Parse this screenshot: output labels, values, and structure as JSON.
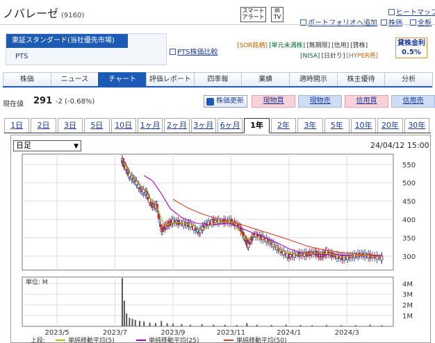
{
  "header": {
    "title": "ノバレーゼ",
    "code": "(9160)",
    "smart_alert": "スマート\nアラート",
    "ir_tv": "IR\nTV",
    "heatmap": "ヒートマップ",
    "portfolio_add": "ポートフォリオへ追加",
    "stock_price": "株価",
    "all_board": "全板"
  },
  "market": {
    "selected": "東証スタンダード(当社優先市場)",
    "pts": "PTS",
    "pts_compare": "PTS株価比較"
  },
  "tags": {
    "row1": [
      "[SOR銘柄]",
      "[単元未満株]",
      "[無期限]",
      "[信用]",
      "[貸株]"
    ],
    "row2": [
      "[NISA]",
      "[日計り]",
      "[HYPER売]"
    ]
  },
  "fee": {
    "label": "貸株金利",
    "value": "0.5%"
  },
  "tabs": [
    "株価",
    "ニュース",
    "チャート",
    "評価レポート",
    "四季報",
    "業績",
    "適時開示",
    "株主優待",
    "分析"
  ],
  "active_tab": "チャート",
  "price": {
    "label": "現在値",
    "value": "291",
    "change": "-2 (-0.68%)"
  },
  "actions": {
    "update": "株価更新",
    "genbutsu_buy": "現物買",
    "genbutsu_sell": "現物売",
    "shinyo_buy": "信用買",
    "shinyo_sell": "信用売"
  },
  "periods": [
    "1日",
    "2日",
    "3日",
    "5日",
    "10日",
    "1ヶ月",
    "2ヶ月",
    "3ヶ月",
    "6ヶ月",
    "1年",
    "2年",
    "3年",
    "5年",
    "10年",
    "20年",
    "30年"
  ],
  "active_period": "1年",
  "chart": {
    "select_value": "日足",
    "date": "24/04/12 15:00",
    "volume_unit": "単位: M",
    "legend_prefix": "上段:",
    "legend": [
      "単純移動平均(5)",
      "単純移動平均(25)",
      "単純移動平均(50)"
    ]
  },
  "chart_data": {
    "type": "candlestick",
    "price_axis": {
      "ticks": [
        550,
        500,
        450,
        400,
        350,
        300
      ],
      "ylim": [
        262,
        578
      ]
    },
    "volume_axis": {
      "ticks": [
        "4M",
        "3M",
        "2M",
        "1M"
      ],
      "ylim": [
        0,
        4.6
      ]
    },
    "x_ticks": [
      "2023/5",
      "2023/7",
      "2023/9",
      "2023/11",
      "2024/1",
      "2024/3"
    ],
    "x_tick_months": [
      0,
      2,
      4,
      6,
      8,
      10
    ],
    "x_range_months": [
      -1.2,
      11.6
    ],
    "price_series": [
      {
        "m": 2.25,
        "v": 560
      },
      {
        "m": 2.35,
        "v": 545
      },
      {
        "m": 2.5,
        "v": 520
      },
      {
        "m": 2.7,
        "v": 505
      },
      {
        "m": 2.9,
        "v": 480
      },
      {
        "m": 3.1,
        "v": 470
      },
      {
        "m": 3.25,
        "v": 440
      },
      {
        "m": 3.45,
        "v": 435
      },
      {
        "m": 3.6,
        "v": 370
      },
      {
        "m": 3.8,
        "v": 385
      },
      {
        "m": 4.0,
        "v": 395
      },
      {
        "m": 4.3,
        "v": 390
      },
      {
        "m": 4.6,
        "v": 385
      },
      {
        "m": 4.9,
        "v": 365
      },
      {
        "m": 5.1,
        "v": 385
      },
      {
        "m": 5.4,
        "v": 395
      },
      {
        "m": 5.7,
        "v": 395
      },
      {
        "m": 6.0,
        "v": 395
      },
      {
        "m": 6.3,
        "v": 380
      },
      {
        "m": 6.5,
        "v": 345
      },
      {
        "m": 6.6,
        "v": 330
      },
      {
        "m": 6.8,
        "v": 360
      },
      {
        "m": 7.1,
        "v": 350
      },
      {
        "m": 7.4,
        "v": 335
      },
      {
        "m": 7.7,
        "v": 315
      },
      {
        "m": 8.0,
        "v": 300
      },
      {
        "m": 8.3,
        "v": 305
      },
      {
        "m": 8.6,
        "v": 305
      },
      {
        "m": 8.9,
        "v": 310
      },
      {
        "m": 9.1,
        "v": 300
      },
      {
        "m": 9.3,
        "v": 310
      },
      {
        "m": 9.6,
        "v": 300
      },
      {
        "m": 9.9,
        "v": 295
      },
      {
        "m": 10.2,
        "v": 300
      },
      {
        "m": 10.5,
        "v": 305
      },
      {
        "m": 10.8,
        "v": 300
      },
      {
        "m": 11.2,
        "v": 295
      }
    ],
    "ma5": [
      {
        "m": 2.3,
        "v": 555
      },
      {
        "m": 2.6,
        "v": 515
      },
      {
        "m": 3.0,
        "v": 480
      },
      {
        "m": 3.4,
        "v": 440
      },
      {
        "m": 3.7,
        "v": 385
      },
      {
        "m": 4.1,
        "v": 392
      },
      {
        "m": 4.6,
        "v": 387
      },
      {
        "m": 5.0,
        "v": 372
      },
      {
        "m": 5.5,
        "v": 393
      },
      {
        "m": 6.1,
        "v": 393
      },
      {
        "m": 6.5,
        "v": 345
      },
      {
        "m": 6.8,
        "v": 356
      },
      {
        "m": 7.3,
        "v": 340
      },
      {
        "m": 7.8,
        "v": 312
      },
      {
        "m": 8.3,
        "v": 304
      },
      {
        "m": 8.9,
        "v": 308
      },
      {
        "m": 9.4,
        "v": 306
      },
      {
        "m": 9.9,
        "v": 297
      },
      {
        "m": 10.5,
        "v": 303
      },
      {
        "m": 11.2,
        "v": 296
      }
    ],
    "ma25": [
      {
        "m": 3.0,
        "v": 520
      },
      {
        "m": 3.3,
        "v": 505
      },
      {
        "m": 3.6,
        "v": 470
      },
      {
        "m": 3.9,
        "v": 430
      },
      {
        "m": 4.3,
        "v": 405
      },
      {
        "m": 4.8,
        "v": 390
      },
      {
        "m": 5.3,
        "v": 385
      },
      {
        "m": 5.9,
        "v": 390
      },
      {
        "m": 6.4,
        "v": 375
      },
      {
        "m": 7.0,
        "v": 355
      },
      {
        "m": 7.5,
        "v": 340
      },
      {
        "m": 8.0,
        "v": 320
      },
      {
        "m": 8.5,
        "v": 307
      },
      {
        "m": 9.0,
        "v": 305
      },
      {
        "m": 9.6,
        "v": 305
      },
      {
        "m": 10.2,
        "v": 300
      },
      {
        "m": 10.8,
        "v": 301
      },
      {
        "m": 11.2,
        "v": 300
      }
    ],
    "ma50": [
      {
        "m": 4.0,
        "v": 455
      },
      {
        "m": 4.5,
        "v": 432
      },
      {
        "m": 5.0,
        "v": 415
      },
      {
        "m": 5.6,
        "v": 400
      },
      {
        "m": 6.2,
        "v": 390
      },
      {
        "m": 6.8,
        "v": 375
      },
      {
        "m": 7.4,
        "v": 360
      },
      {
        "m": 8.0,
        "v": 345
      },
      {
        "m": 8.6,
        "v": 328
      },
      {
        "m": 9.2,
        "v": 317
      },
      {
        "m": 9.8,
        "v": 310
      },
      {
        "m": 10.4,
        "v": 305
      },
      {
        "m": 11.2,
        "v": 302
      }
    ],
    "volume": [
      {
        "m": 2.25,
        "v": 4.5
      },
      {
        "m": 2.32,
        "v": 2.4
      },
      {
        "m": 2.4,
        "v": 1.2
      },
      {
        "m": 2.5,
        "v": 0.8
      },
      {
        "m": 2.6,
        "v": 0.7
      },
      {
        "m": 2.7,
        "v": 0.6
      },
      {
        "m": 2.85,
        "v": 0.5
      },
      {
        "m": 3.0,
        "v": 0.45
      },
      {
        "m": 3.2,
        "v": 0.35
      },
      {
        "m": 3.4,
        "v": 0.3
      },
      {
        "m": 3.6,
        "v": 0.5
      },
      {
        "m": 3.8,
        "v": 0.3
      },
      {
        "m": 4.0,
        "v": 0.25
      },
      {
        "m": 4.3,
        "v": 0.2
      },
      {
        "m": 4.6,
        "v": 0.15
      },
      {
        "m": 5.0,
        "v": 0.2
      },
      {
        "m": 5.4,
        "v": 0.15
      },
      {
        "m": 5.8,
        "v": 0.15
      },
      {
        "m": 6.2,
        "v": 0.12
      },
      {
        "m": 6.55,
        "v": 0.3
      },
      {
        "m": 6.9,
        "v": 0.15
      },
      {
        "m": 7.4,
        "v": 0.12
      },
      {
        "m": 7.9,
        "v": 0.15
      },
      {
        "m": 8.4,
        "v": 0.12
      },
      {
        "m": 8.8,
        "v": 0.1
      },
      {
        "m": 9.3,
        "v": 0.12
      },
      {
        "m": 9.8,
        "v": 0.1
      },
      {
        "m": 10.3,
        "v": 0.1
      },
      {
        "m": 10.8,
        "v": 0.15
      },
      {
        "m": 11.2,
        "v": 0.1
      }
    ],
    "colors": {
      "ma5": "#b8b400",
      "ma25": "#b000c8",
      "ma50": "#d84020",
      "up": "#1c5bb5",
      "down": "#c03030"
    }
  }
}
